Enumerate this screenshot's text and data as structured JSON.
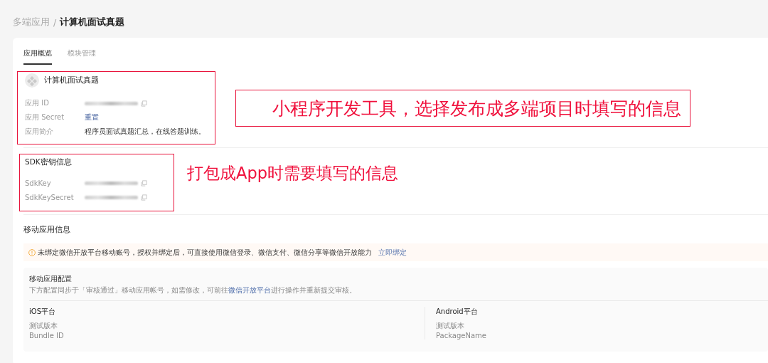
{
  "breadcrumb": {
    "parent": "多端应用",
    "separator": "/",
    "current": "计算机面试真题"
  },
  "tabs": [
    {
      "label": "应用概览",
      "selected": true
    },
    {
      "label": "模块管理",
      "selected": false
    }
  ],
  "app": {
    "name": "计算机面试真题",
    "fields": [
      {
        "label": "应用 ID",
        "kind": "masked",
        "copyable": true
      },
      {
        "label": "应用 Secret",
        "kind": "link",
        "value": "重置"
      },
      {
        "label": "应用简介",
        "kind": "text",
        "value": "程序员面试真题汇总，在线答题训练。"
      }
    ]
  },
  "sdk": {
    "title": "SDK密钥信息",
    "fields": [
      {
        "label": "SdkKey",
        "kind": "masked",
        "copyable": true
      },
      {
        "label": "SdkKeySecret",
        "kind": "masked",
        "copyable": true
      }
    ]
  },
  "mobile": {
    "title": "移动应用信息",
    "notice": {
      "text": "未绑定微信开放平台移动账号，授权并绑定后，可直接使用微信登录、微信支付、微信分享等微信开放能力",
      "link": "立即绑定"
    },
    "config": {
      "title": "移动应用配置",
      "description_before": "下方配置同步于「审核通过」移动应用帐号，如需修改，可前往",
      "description_link": "微信开放平台",
      "description_after": "进行操作并重新提交审核。"
    },
    "platforms": [
      {
        "title": "iOS平台",
        "fields": [
          "测试版本",
          "Bundle ID"
        ]
      },
      {
        "title": "Android平台",
        "fields": [
          "测试版本",
          "PackageName"
        ]
      }
    ]
  },
  "annotations": [
    {
      "text": "小程序开发工具，选择发布成多端项目时填写的信息"
    },
    {
      "text": "打包成App时需要填写的信息"
    }
  ]
}
